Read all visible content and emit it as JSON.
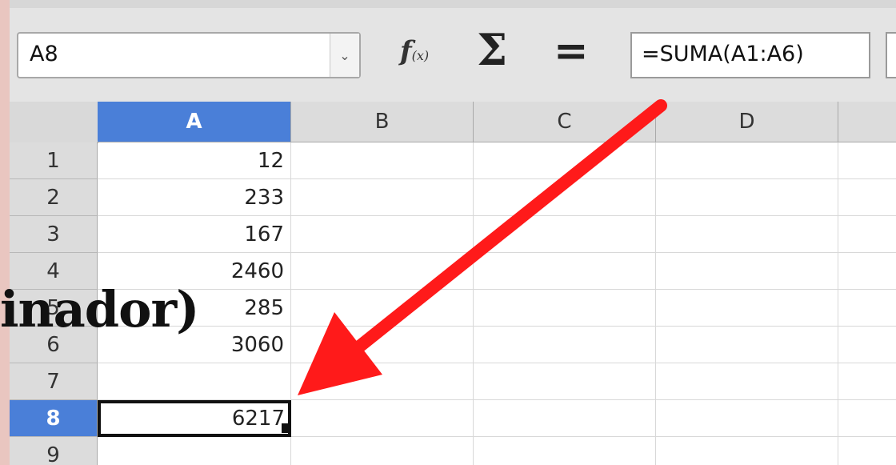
{
  "name_box": {
    "value": "A8"
  },
  "formula_bar": {
    "fx_label": "f(x)",
    "sum_symbol": "Σ",
    "equals_symbol": "=",
    "value": "=SUMA(A1:A6)"
  },
  "columns": [
    "A",
    "B",
    "C",
    "D"
  ],
  "active_column": "A",
  "rows": [
    {
      "num": "1",
      "a": "12"
    },
    {
      "num": "2",
      "a": "233"
    },
    {
      "num": "3",
      "a": "167"
    },
    {
      "num": "4",
      "a": "2460"
    },
    {
      "num": "5",
      "a": "285"
    },
    {
      "num": "6",
      "a": "3060"
    },
    {
      "num": "7",
      "a": ""
    },
    {
      "num": "8",
      "a": "6217"
    },
    {
      "num": "9",
      "a": ""
    }
  ],
  "active_row": "8",
  "overlay_text": "inador)",
  "colors": {
    "highlight": "#ff1a1a",
    "selection": "#4a7fd8"
  }
}
